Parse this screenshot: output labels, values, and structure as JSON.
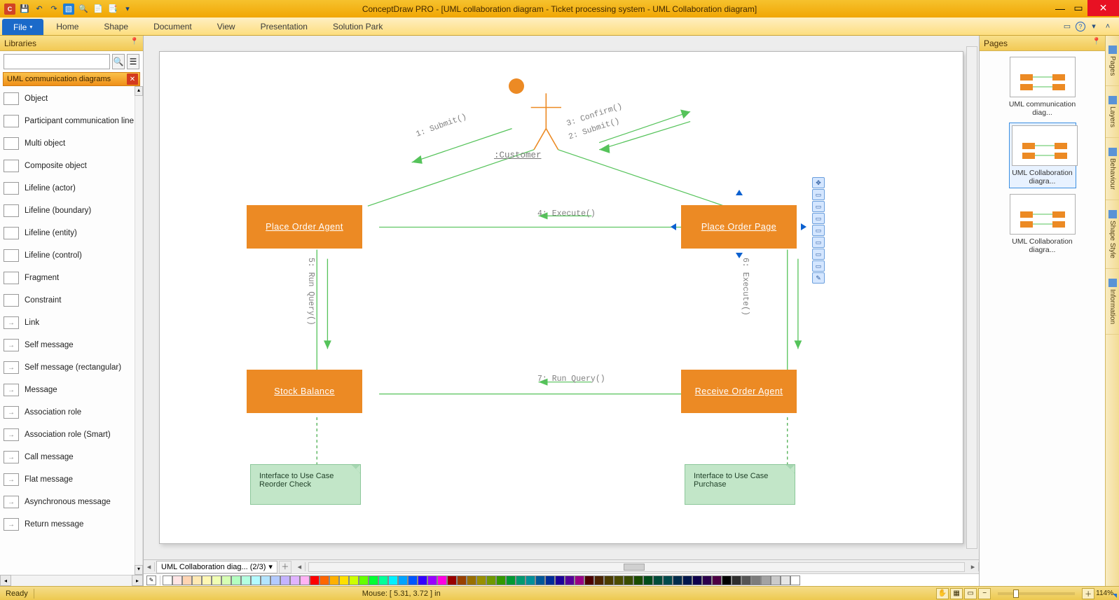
{
  "app": {
    "title": "ConceptDraw PRO - [UML collaboration diagram - Ticket processing system - UML Collaboration diagram]",
    "file_label": "File"
  },
  "menu": [
    "Home",
    "Shape",
    "Document",
    "View",
    "Presentation",
    "Solution Park"
  ],
  "panels": {
    "libraries_title": "Libraries",
    "pages_title": "Pages"
  },
  "libraries": {
    "search_placeholder": "",
    "category": "UML communication diagrams",
    "items": [
      "Object",
      "Participant communication line",
      "Multi object",
      "Composite object",
      "Lifeline (actor)",
      "Lifeline (boundary)",
      "Lifeline (entity)",
      "Lifeline (control)",
      "Fragment",
      "Constraint",
      "Link",
      "Self message",
      "Self message (rectangular)",
      "Message",
      "Association role",
      "Association role (Smart)",
      "Call message",
      "Flat message",
      "Asynchronous message",
      "Return message"
    ]
  },
  "diagram": {
    "actor": ":Customer",
    "nodes": {
      "place_order_agent": "Place Order Agent",
      "place_order_page": "Place Order Page",
      "stock_balance": "Stock Balance",
      "receive_order_agent": "Receive Order Agent"
    },
    "edges": {
      "e1": "1: Submit()",
      "e2": "2: Submit()",
      "e3": "3: Confirm()",
      "e4": "4: Execute()",
      "e5": "5: Run Query()",
      "e6": "6: Execute()",
      "e7": "7: Run Query()"
    },
    "notes": {
      "n1": "Interface to Use Case Reorder Check",
      "n2": "Interface to Use Case Purchase"
    }
  },
  "pages": [
    {
      "label": "UML communication diag...",
      "selected": false
    },
    {
      "label": "UML Collaboration diagra...",
      "selected": true
    },
    {
      "label": "UML Collaboration diagra...",
      "selected": false
    }
  ],
  "side_tabs": [
    "Pages",
    "Layers",
    "Behaviour",
    "Shape Style",
    "Information"
  ],
  "bottom_tab": "UML Collaboration diag... (2/3)",
  "status": {
    "ready": "Ready",
    "mouse": "Mouse: [ 5.31, 3.72 ] in",
    "zoom": "114%"
  },
  "colors": [
    "#ffffff",
    "#ffe5e5",
    "#ffd4b3",
    "#ffe9b3",
    "#fff7b3",
    "#f0ffb3",
    "#d6ffb3",
    "#b3ffc0",
    "#b3ffe0",
    "#b3fbff",
    "#b3e4ff",
    "#b3caff",
    "#c4b3ff",
    "#e0b3ff",
    "#ffb3f4",
    "#ff0000",
    "#ff6600",
    "#ffb000",
    "#ffe000",
    "#ccff00",
    "#66ff00",
    "#00ff33",
    "#00ff99",
    "#00f0ff",
    "#00a3ff",
    "#0055ff",
    "#3300ff",
    "#9900ff",
    "#ff00e0",
    "#990000",
    "#994000",
    "#997000",
    "#999000",
    "#709900",
    "#339900",
    "#009933",
    "#009970",
    "#009099",
    "#005799",
    "#002b99",
    "#1c0099",
    "#550099",
    "#990085",
    "#4c0000",
    "#4c2300",
    "#4c3c00",
    "#4c4c00",
    "#3a4c00",
    "#1a4c00",
    "#004c1a",
    "#004c39",
    "#004a4c",
    "#002c4c",
    "#00164c",
    "#0e004c",
    "#2b004c",
    "#4c0043",
    "#000000",
    "#2e2e2e",
    "#555555",
    "#7c7c7c",
    "#a3a3a3",
    "#cacaca",
    "#e6e6e6",
    "#ffffff"
  ]
}
